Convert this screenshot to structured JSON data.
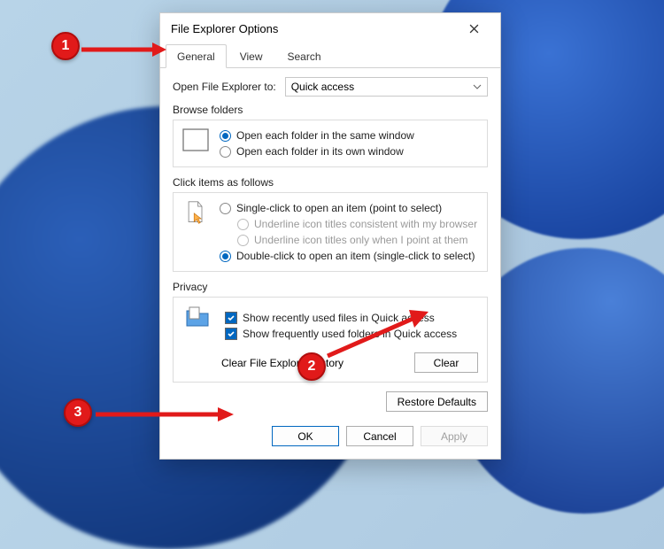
{
  "dialog": {
    "title": "File Explorer Options",
    "tabs": {
      "general": "General",
      "view": "View",
      "search": "Search"
    },
    "openExplorer": {
      "label": "Open File Explorer to:",
      "value": "Quick access"
    },
    "browseFolders": {
      "label": "Browse folders",
      "same": "Open each folder in the same window",
      "own": "Open each folder in its own window"
    },
    "clickItems": {
      "label": "Click items as follows",
      "single": "Single-click to open an item (point to select)",
      "underlineBrowser": "Underline icon titles consistent with my browser",
      "underlinePoint": "Underline icon titles only when I point at them",
      "double": "Double-click to open an item (single-click to select)"
    },
    "privacy": {
      "label": "Privacy",
      "recent": "Show recently used files in Quick access",
      "frequent": "Show frequently used folders in Quick access",
      "clearLabel": "Clear File Explorer history",
      "clearBtn": "Clear"
    },
    "restore": "Restore Defaults",
    "footer": {
      "ok": "OK",
      "cancel": "Cancel",
      "apply": "Apply"
    }
  },
  "annotations": {
    "m1": "1",
    "m2": "2",
    "m3": "3"
  }
}
